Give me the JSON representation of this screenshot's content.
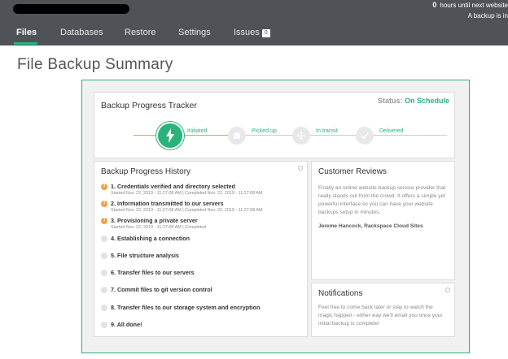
{
  "header": {
    "countdown_value": "0",
    "countdown_text": "hours until next website",
    "note": "A backup is in"
  },
  "nav": {
    "tabs": [
      {
        "label": "Files",
        "active": true
      },
      {
        "label": "Databases",
        "active": false
      },
      {
        "label": "Restore",
        "active": false
      },
      {
        "label": "Settings",
        "active": false
      },
      {
        "label": "Issues",
        "active": false,
        "badge": "0"
      }
    ]
  },
  "page_title": "File Backup Summary",
  "tracker": {
    "title": "Backup Progress Tracker",
    "status_label": "Status:",
    "status_value": "On Schedule",
    "steps": [
      {
        "label": "Initiated",
        "icon": "lightning-icon",
        "state": "active"
      },
      {
        "label": "Picked up",
        "icon": "box-icon",
        "state": "pending"
      },
      {
        "label": "In transit",
        "icon": "move-icon",
        "state": "pending"
      },
      {
        "label": "Delivered",
        "icon": "check-icon",
        "state": "pending"
      }
    ]
  },
  "history": {
    "title": "Backup Progress History",
    "items": [
      {
        "label": "1. Credentials verified and directory selected",
        "meta": "Started Nov. 22, 2019 - 11:27:08 AM | Completed Nov. 22, 2019 - 11:27:08 AM",
        "state": "done"
      },
      {
        "label": "2. Information transmitted to our servers",
        "meta": "Started Nov. 22, 2019 - 11:27:08 AM | Completed Nov. 22, 2019 - 11:27:08 AM",
        "state": "done"
      },
      {
        "label": "3. Provisioning a private server",
        "meta": "Started Nov. 22, 2019 - 11:27:08 AM | Completed",
        "state": "done"
      },
      {
        "label": "4. Establishing a connection",
        "meta": "",
        "state": "pending"
      },
      {
        "label": "5. File structure analysis",
        "meta": "",
        "state": "pending"
      },
      {
        "label": "6. Transfer files to our servers",
        "meta": "",
        "state": "pending"
      },
      {
        "label": "7. Commit files to git version control",
        "meta": "",
        "state": "pending"
      },
      {
        "label": "8. Transfer files to our storage system and encryption",
        "meta": "",
        "state": "pending"
      },
      {
        "label": "9. All done!",
        "meta": "",
        "state": "pending"
      }
    ]
  },
  "reviews": {
    "title": "Customer Reviews",
    "text": "Finally an online website backup service provider that really stands out from the crowd. It offers a simple yet powerful interface so you can have your website backups setup in minutes.",
    "author": "Jereme Hancock, Rackspace Cloud Sites"
  },
  "notifications": {
    "title": "Notifications",
    "text": "Feel free to come back later or stay to watch the magic happen - either way we'll email you once your initial backup is complete!"
  },
  "colors": {
    "accent": "#2ab27b",
    "warning": "#f0a24a",
    "topbar": "#4f5257"
  }
}
